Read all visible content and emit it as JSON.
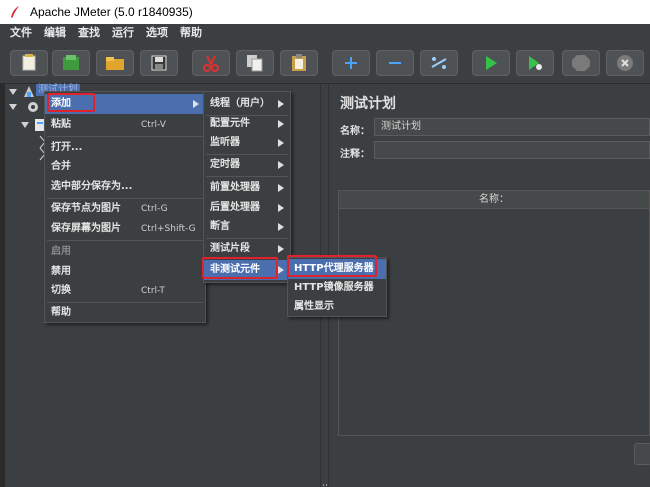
{
  "window": {
    "title": "Apache JMeter (5.0 r1840935)"
  },
  "menubar": [
    "文件",
    "编辑",
    "查找",
    "运行",
    "选项",
    "帮助"
  ],
  "toolbar": {
    "buttons": [
      "new-icon",
      "templates-icon",
      "open-icon",
      "save-icon",
      "cut-icon",
      "copy-icon",
      "paste-icon",
      "expand-icon",
      "collapse-icon",
      "toggle-icon",
      "start-icon",
      "start-no-pause-icon",
      "stop-icon",
      "shutdown-icon"
    ]
  },
  "tree": {
    "root_label": "测试计划"
  },
  "context_menu": {
    "items": [
      {
        "label": "添加",
        "shortcut": "",
        "submenu": true,
        "selected": true
      },
      {
        "label": "粘贴",
        "shortcut": "Ctrl-V"
      },
      {
        "label": "打开...",
        "shortcut": ""
      },
      {
        "label": "合并",
        "shortcut": ""
      },
      {
        "label": "选中部分保存为...",
        "shortcut": ""
      },
      {
        "label": "保存节点为图片",
        "shortcut": "Ctrl-G"
      },
      {
        "label": "保存屏幕为图片",
        "shortcut": "Ctrl+Shift-G"
      },
      {
        "label": "启用",
        "shortcut": "",
        "disabled": true
      },
      {
        "label": "禁用",
        "shortcut": ""
      },
      {
        "label": "切换",
        "shortcut": "Ctrl-T"
      },
      {
        "label": "帮助",
        "shortcut": ""
      }
    ]
  },
  "add_submenu": {
    "items": [
      {
        "label": "线程（用户）"
      },
      {
        "label": "配置元件"
      },
      {
        "label": "监听器"
      },
      {
        "label": "定时器"
      },
      {
        "label": "前置处理器"
      },
      {
        "label": "后置处理器"
      },
      {
        "label": "断言"
      },
      {
        "label": "测试片段"
      },
      {
        "label": "非测试元件"
      }
    ]
  },
  "non_test_submenu": {
    "items": [
      {
        "label": "HTTP代理服务器"
      },
      {
        "label": "HTTP镜像服务器"
      },
      {
        "label": "属性显示"
      }
    ]
  },
  "right_panel": {
    "title": "测试计划",
    "name_label": "名称：",
    "name_value": "测试计划",
    "comment_label": "注释：",
    "comment_value": "",
    "table_header": "名称："
  },
  "colors": {
    "background": "#3c3f41",
    "selection": "#4b6eaf",
    "highlight_box": "#e0222c"
  }
}
